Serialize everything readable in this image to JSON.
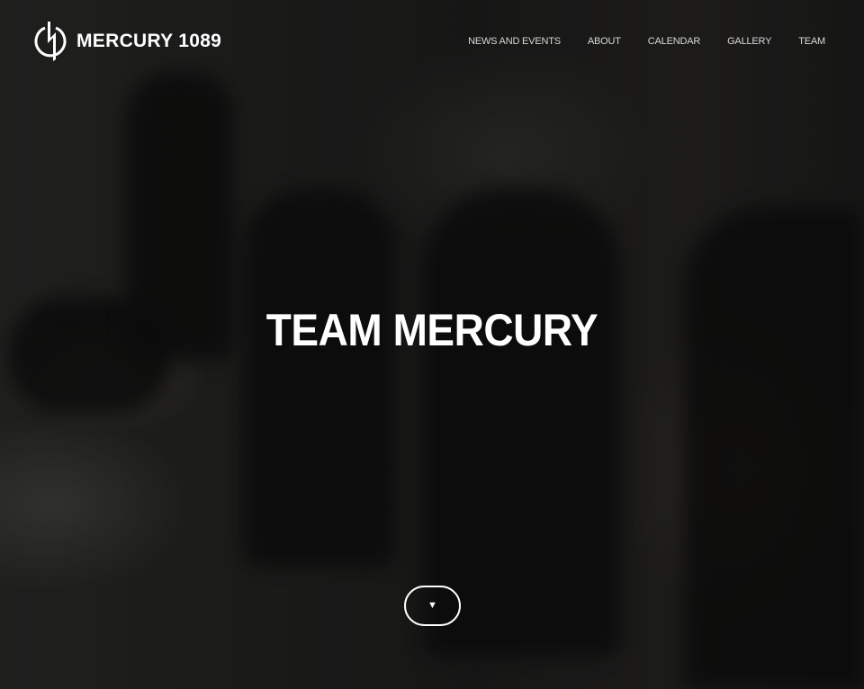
{
  "brand": {
    "name": "MERCURY 1089",
    "logo_icon": "mercury-bolt-logo"
  },
  "nav": {
    "items": [
      {
        "label": "NEWS AND EVENTS"
      },
      {
        "label": "ABOUT"
      },
      {
        "label": "CALENDAR"
      },
      {
        "label": "GALLERY"
      },
      {
        "label": "TEAM"
      }
    ]
  },
  "hero": {
    "title": "TEAM MERCURY",
    "scroll_button": {
      "icon": "caret-down-icon",
      "glyph": "▼"
    }
  },
  "colors": {
    "text": "#ffffff",
    "background": "#1c1c1c"
  }
}
